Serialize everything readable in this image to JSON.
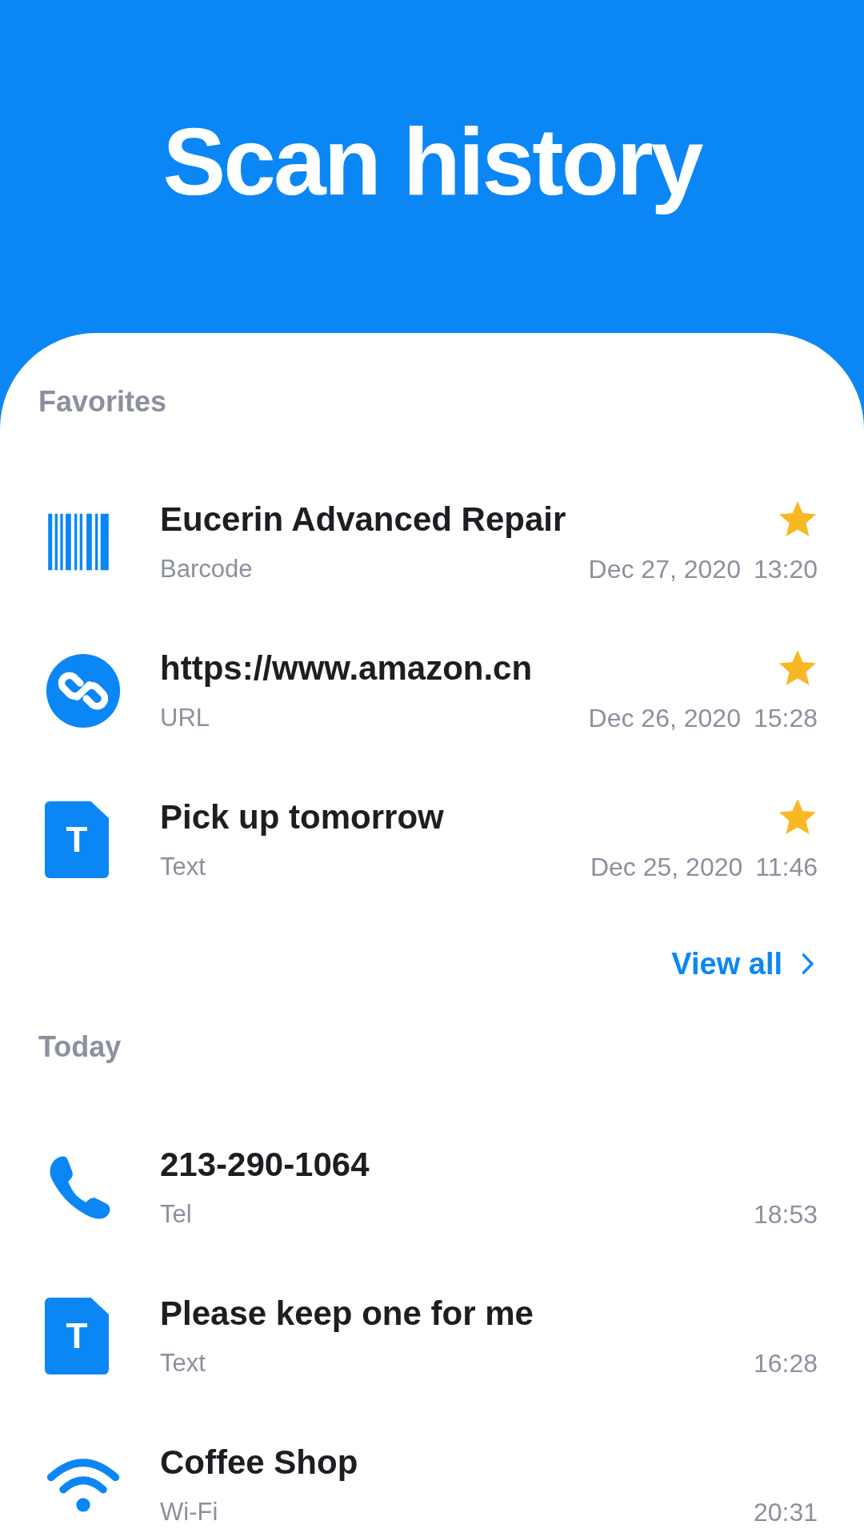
{
  "header": {
    "title": "Scan history"
  },
  "sections": [
    {
      "label": "Favorites",
      "items": [
        {
          "kind": "barcode",
          "title": "Eucerin Advanced Repair",
          "type": "Barcode",
          "date": "Dec 27, 2020",
          "time": "13:20",
          "favorite": true
        },
        {
          "kind": "link",
          "title": "https://www.amazon.cn",
          "type": "URL",
          "date": "Dec 26, 2020",
          "time": "15:28",
          "favorite": true
        },
        {
          "kind": "text",
          "icon_text": "T",
          "title": "Pick up tomorrow",
          "type": "Text",
          "date": "Dec 25, 2020",
          "time": "11:46",
          "favorite": true
        }
      ],
      "link": "View all"
    },
    {
      "label": "Today",
      "items": [
        {
          "kind": "phone",
          "title": "213-290-1064",
          "type": "Tel",
          "time": "18:53",
          "favorite": false
        },
        {
          "kind": "text",
          "icon_text": "T",
          "title": "Please keep one for me",
          "type": "Text",
          "time": "16:28",
          "favorite": false
        },
        {
          "kind": "wifi",
          "title": "Coffee Shop",
          "type": "Wi-Fi",
          "time": "20:31",
          "favorite": false
        }
      ]
    }
  ]
}
